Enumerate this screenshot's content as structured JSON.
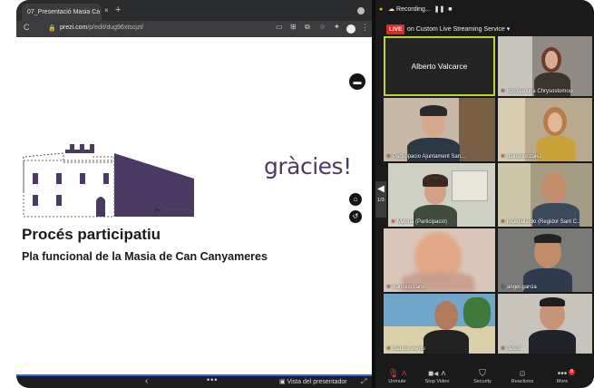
{
  "browser": {
    "tab_title": "07_Presentació Masia Ca",
    "tab_close": "×",
    "new_tab": "+",
    "url_domain": "prezi.com",
    "url_path": "/p/edit/dug96xtscjzt/",
    "back_icon": "C",
    "lock_icon": "lock-icon"
  },
  "slide": {
    "closing_word": "gràcies!",
    "title": "Procés participatiu",
    "subtitle": "Pla funcional de la Masia de Can Canyameres"
  },
  "prezi_bar": {
    "prev": "‹",
    "more": "•••",
    "presenter_view": "Vista del presentador"
  },
  "zoom": {
    "recording_label": "Recording...",
    "live_badge": "LIVE",
    "live_text": "on Custom Live Streaming Service",
    "page_indicator": "1/3",
    "participants": [
      {
        "name": "Alberto Valcarce"
      },
      {
        "name": "Konstantina Chrysostomou"
      },
      {
        "name": "Participacio Ajuntament San..."
      },
      {
        "name": "dianagonzalez"
      },
      {
        "name": "Marina (Participació)"
      },
      {
        "name": "josegallardo (Regidor Sant C..."
      },
      {
        "name": "francesccarol"
      },
      {
        "name": "angel.garcia"
      },
      {
        "name": "claudio verdu"
      },
      {
        "name": "Jesús"
      }
    ],
    "toolbar": {
      "unmute": "Unmute",
      "stop_video": "Stop Video",
      "security": "Security",
      "reactions": "Reactions",
      "more": "More",
      "more_badge": "8"
    }
  },
  "colors": {
    "accent_purple": "#4a3a62",
    "live_red": "#e02828",
    "active_speaker": "#b8d43a"
  }
}
